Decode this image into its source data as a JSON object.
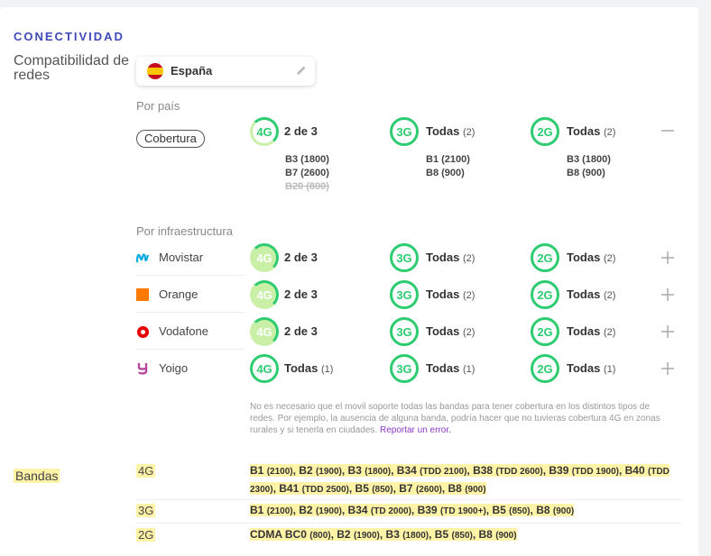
{
  "section_title": "CONECTIVIDAD",
  "compat": {
    "label": "Compatibilidad de redes",
    "country": "España",
    "by_country_label": "Por país",
    "coverage_pill": "Cobertura",
    "coverage": [
      {
        "tech": "4G",
        "summary": "2 de 3",
        "count": "",
        "bands": [
          "B3 (1800)",
          "B7 (2600)"
        ],
        "missing": [
          "B20 (800)"
        ]
      },
      {
        "tech": "3G",
        "summary": "Todas",
        "count": "(2)",
        "bands": [
          "B1 (2100)",
          "B8 (900)"
        ],
        "missing": []
      },
      {
        "tech": "2G",
        "summary": "Todas",
        "count": "(2)",
        "bands": [
          "B3 (1800)",
          "B8 (900)"
        ],
        "missing": []
      }
    ],
    "by_infra_label": "Por infraestructura",
    "operators": [
      {
        "name": "Movistar",
        "cells": [
          {
            "tech": "4G",
            "summary": "2 de 3",
            "count": ""
          },
          {
            "tech": "3G",
            "summary": "Todas",
            "count": "(2)"
          },
          {
            "tech": "2G",
            "summary": "Todas",
            "count": "(2)"
          }
        ]
      },
      {
        "name": "Orange",
        "cells": [
          {
            "tech": "4G",
            "summary": "2 de 3",
            "count": ""
          },
          {
            "tech": "3G",
            "summary": "Todas",
            "count": "(2)"
          },
          {
            "tech": "2G",
            "summary": "Todas",
            "count": "(2)"
          }
        ]
      },
      {
        "name": "Vodafone",
        "cells": [
          {
            "tech": "4G",
            "summary": "2 de 3",
            "count": ""
          },
          {
            "tech": "3G",
            "summary": "Todas",
            "count": "(2)"
          },
          {
            "tech": "2G",
            "summary": "Todas",
            "count": "(2)"
          }
        ]
      },
      {
        "name": "Yoigo",
        "cells": [
          {
            "tech": "4G",
            "summary": "Todas",
            "count": "(1)"
          },
          {
            "tech": "3G",
            "summary": "Todas",
            "count": "(1)"
          },
          {
            "tech": "2G",
            "summary": "Todas",
            "count": "(1)"
          }
        ]
      }
    ],
    "note": "No es necesario que el movil soporte todas las bandas para tener cobertura en los distintos tipos de redes. Por ejemplo, la ausencia de alguna banda, podría hacer que no tuvieras cobertura 4G en zonas rurales y si tenerla en ciudades.",
    "note_link": "Reportar un error."
  },
  "bandas": {
    "label": "Bandas",
    "rows": [
      {
        "tech": "4G",
        "bands": [
          [
            "B1",
            "(2100)"
          ],
          [
            "B2",
            "(1900)"
          ],
          [
            "B3",
            "(1800)"
          ],
          [
            "B34",
            "(TDD 2100)"
          ],
          [
            "B38",
            "(TDD 2600)"
          ],
          [
            "B39",
            "(TDD 1900)"
          ],
          [
            "B40",
            "(TDD 2300)"
          ],
          [
            "B41",
            "(TDD 2500)"
          ],
          [
            "B5",
            "(850)"
          ],
          [
            "B7",
            "(2600)"
          ],
          [
            "B8",
            "(900)"
          ]
        ]
      },
      {
        "tech": "3G",
        "bands": [
          [
            "B1",
            "(2100)"
          ],
          [
            "B2",
            "(1900)"
          ],
          [
            "B34",
            "(TD 2000)"
          ],
          [
            "B39",
            "(TD 1900+)"
          ],
          [
            "B5",
            "(850)"
          ],
          [
            "B8",
            "(900)"
          ]
        ]
      },
      {
        "tech": "2G",
        "bands": [
          [
            "CDMA BC0",
            "(800)"
          ],
          [
            "B2",
            "(1900)"
          ],
          [
            "B3",
            "(1800)"
          ],
          [
            "B5",
            "(850)"
          ],
          [
            "B8",
            "(900)"
          ]
        ]
      }
    ]
  },
  "colors": {
    "accent": "#3d4bb8",
    "ring_full": "#2ecc71",
    "ring_partial": "#c9f0a6",
    "highlight": "#fff3a8",
    "link": "#8a39c7"
  },
  "icons": {
    "edit": "pencil-icon",
    "expanded": "minus-icon",
    "collapsed": "plus-icon"
  }
}
